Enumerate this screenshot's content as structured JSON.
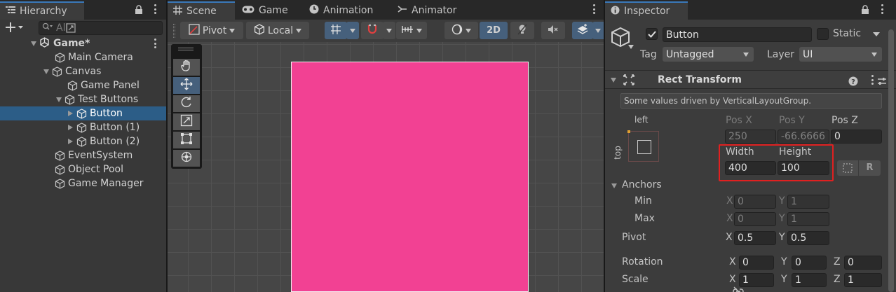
{
  "hierarchy": {
    "tab_label": "Hierarchy",
    "search_placeholder": "All",
    "items": [
      {
        "label": "Game*"
      },
      {
        "label": "Main Camera"
      },
      {
        "label": "Canvas"
      },
      {
        "label": "Game Panel"
      },
      {
        "label": "Test Buttons"
      },
      {
        "label": "Button"
      },
      {
        "label": "Button (1)"
      },
      {
        "label": "Button (2)"
      },
      {
        "label": "EventSystem"
      },
      {
        "label": "Object Pool"
      },
      {
        "label": "Game Manager"
      }
    ]
  },
  "scene": {
    "tabs": [
      {
        "label": "Scene"
      },
      {
        "label": "Game"
      },
      {
        "label": "Animation"
      },
      {
        "label": "Animator"
      }
    ],
    "toolbar": {
      "pivot_label": "Pivot",
      "local_label": "Local",
      "mode_2d_label": "2D"
    },
    "colors": {
      "ui_element": "#f24193",
      "grid": "#464646",
      "accent": "#3a79bb"
    }
  },
  "inspector": {
    "tab_label": "Inspector",
    "object_name": "Button",
    "active_checked": true,
    "static_label": "Static",
    "tag_label": "Tag",
    "tag_value": "Untagged",
    "layer_label": "Layer",
    "layer_value": "UI",
    "rect_transform": {
      "title": "Rect Transform",
      "driven_note": "Some values driven by VerticalLayoutGroup.",
      "anchor_preset_top": "left",
      "anchor_preset_side": "top",
      "pos_x_label": "Pos X",
      "pos_x": "250",
      "pos_y_label": "Pos Y",
      "pos_y": "-66.6666",
      "pos_z_label": "Pos Z",
      "pos_z": "0",
      "width_label": "Width",
      "width": "400",
      "height_label": "Height",
      "height": "100",
      "raw_button_label": "R",
      "anchors_label": "Anchors",
      "min_label": "Min",
      "min_x": "0",
      "min_y": "1",
      "max_label": "Max",
      "max_x": "0",
      "max_y": "1",
      "pivot_label": "Pivot",
      "pivot_x": "0.5",
      "pivot_y": "0.5",
      "rotation_label": "Rotation",
      "rot_x": "0",
      "rot_y": "0",
      "rot_z": "0",
      "scale_label": "Scale",
      "scale_x": "1",
      "scale_y": "1",
      "scale_z": "1",
      "x_axis": "X",
      "y_axis": "Y",
      "z_axis": "Z"
    },
    "highlight_color": "#e02020"
  }
}
